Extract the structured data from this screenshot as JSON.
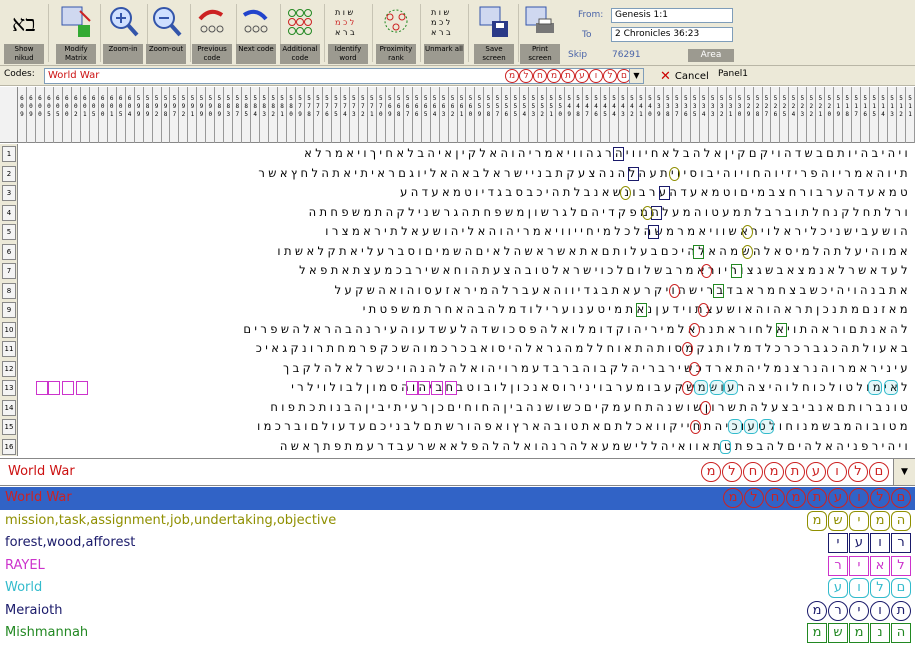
{
  "toolbar": {
    "buttons": [
      {
        "label": "Show nikud",
        "icon": "bet-alef-icon"
      },
      {
        "label": "Modify Matrix",
        "icon": "matrix-icon"
      },
      {
        "label": "Zoom-in",
        "icon": "zoom-in-icon"
      },
      {
        "label": "Zoom-out",
        "icon": "zoom-out-icon"
      },
      {
        "label": "Previous code",
        "icon": "previous-code-icon"
      },
      {
        "label": "Next code",
        "icon": "next-code-icon"
      },
      {
        "label": "Additional code",
        "icon": "additional-code-icon"
      },
      {
        "label": "Identify word",
        "icon": "identify-word-icon"
      },
      {
        "label": "Proximity rank",
        "icon": "proximity-rank-icon"
      },
      {
        "label": "Unmark all",
        "icon": "unmark-all-icon"
      },
      {
        "label": "Save screen",
        "icon": "save-screen-icon"
      },
      {
        "label": "Print screen",
        "icon": "print-screen-icon"
      }
    ]
  },
  "range": {
    "from_label": "From:",
    "from_value": "Genesis 1:1",
    "to_label": "To",
    "to_value": "2 Chronicles 36:23",
    "skip_label": "Skip",
    "skip_value": "76291",
    "area_label": "Area"
  },
  "codes": {
    "label": "Codes:",
    "value": "World War",
    "highlight": "מלחמתעולם",
    "cancel_label": "Cancel",
    "panel_label": "Panel1"
  },
  "column_numbers": [
    "6\n0\n9",
    "6\n0\n9",
    "6\n0\n0",
    "6\n0\n5",
    "6\n0\n5",
    "6\n0\n0",
    "6\n0\n2",
    "6\n0\n1",
    "6\n0\n5",
    "6\n0\n0",
    "6\n0\n1",
    "6\n0\n5",
    "6\n0\n4",
    "5\n9\n9",
    "5\n8\n9",
    "5\n9\n2",
    "5\n9\n8",
    "5\n9\n7",
    "5\n9\n2",
    "5\n9\n1",
    "5\n9\n9",
    "5\n9\n0",
    "5\n8\n9",
    "5\n8\n3",
    "5\n8\n7",
    "5\n8\n5",
    "5\n8\n4",
    "5\n8\n3",
    "5\n8\n2",
    "5\n8\n1",
    "5\n8\n0",
    "5\n7\n9",
    "5\n7\n8",
    "5\n7\n7",
    "5\n7\n6",
    "5\n7\n5",
    "5\n7\n4",
    "5\n7\n3",
    "5\n7\n2",
    "5\n7\n1",
    "5\n7\n0",
    "5\n6\n9",
    "5\n6\n8",
    "5\n6\n7",
    "5\n6\n6",
    "5\n6\n5",
    "5\n6\n4",
    "5\n6\n3",
    "5\n6\n2",
    "5\n6\n1",
    "5\n6\n0",
    "5\n5\n9",
    "5\n5\n8",
    "5\n5\n7",
    "5\n5\n6",
    "5\n5\n5",
    "5\n5\n4",
    "5\n5\n3",
    "5\n5\n2",
    "5\n5\n1",
    "5\n5\n0",
    "5\n4\n9",
    "5\n4\n8",
    "5\n4\n7",
    "5\n4\n6",
    "5\n4\n5",
    "5\n4\n4",
    "5\n4\n3",
    "5\n4\n2",
    "5\n4\n1",
    "5\n4\n0",
    "5\n3\n9",
    "5\n3\n8",
    "5\n3\n7",
    "5\n3\n6",
    "5\n3\n5",
    "5\n3\n4",
    "5\n3\n3",
    "5\n3\n2",
    "5\n3\n1",
    "5\n3\n0",
    "5\n2\n9",
    "5\n2\n8",
    "5\n2\n7",
    "5\n2\n6",
    "5\n2\n5",
    "5\n2\n4",
    "5\n2\n3",
    "5\n2\n2",
    "5\n2\n1",
    "5\n2\n0",
    "5\n1\n9",
    "5\n1\n8",
    "5\n1\n7",
    "5\n1\n6",
    "5\n1\n5",
    "5\n1\n4",
    "5\n1\n3",
    "5\n1\n2",
    "5\n1\n1"
  ],
  "matrix_rows": [
    {
      "num": "1",
      "text": "ויהיבהיותםבשדהויקםקיןאלהבלאחיוויהרגהוויאמריהוהאלקיןאיהבלאחיךויאמרלא"
    },
    {
      "num": "2",
      "text": "תיוהאמריוהפריזיוהחויוהיבוסיויתעהלהנהצעקתבניישראלבאהאליוגםראיתיאתהלחץאשר"
    },
    {
      "num": "3",
      "text": "טמאעדהערבורחצבמיםוטמאעדהערבונשאנבלתהיכבסבגדיוטמאעדהע"
    },
    {
      "num": "4",
      "text": "ורלתחלקנחלתוברבלתמעטוהמעלהמפקדיהםלגרשוןמשפחתהגרשנילקהתמשפחתה"
    },
    {
      "num": "5",
      "text": "הושעבישניכליראלויראשוויאמרמשהלכלמיחייוויאמריהוהאליהושעאלתיראמצרו"
    },
    {
      "num": "6",
      "text": "אמוהיעלתהלמיסאלהשמהאלהיכםבעלותםאתאשראשהלאיםהשמיםוסברעליאתקלאשתו"
    },
    {
      "num": "7",
      "text": "לעדאשרלאנמצאבשגצוריוראמרבשלוםלכוישראלטובהצעתהוחאשירבכמעצתאתפאל"
    },
    {
      "num": "8",
      "text": "אתבנהויהיכשבצחמראבדברישהויקרעאתבגדיווהאעברלהמיראזעסוהואהשקעל"
    },
    {
      "num": "9",
      "text": "מאזנםמתנכןתראהוהאושעצתוידעןנאתמיטענוערילודמלהבהאחרתמשפטתי"
    },
    {
      "num": "10",
      "text": "להאנתםוראהתויאלחוראתנראלמיריהוקדומלואלהפסכושדהלעשדעוהעירנהבהראלהשפרים"
    },
    {
      "num": "11",
      "text": "באעולתהכגברכרכלדמלותגקמסותהתאוחללמהגראלהיסואבכרכמוהשכקפרמחתרונקגאיכ"
    },
    {
      "num": "12",
      "text": "עיניראמרוהנרצנמליהתארדכשירבריהלקבוהברבדעמרויהואלהלהנהויכשרלאלהלקבך"
    },
    {
      "num": "13",
      "text": "לאימולטולכוחלוהיצהרעושמשקעבומערבוינירוסאנכוןלובוטבחביהוהסמוןלבולוילרי"
    },
    {
      "num": "14",
      "text": "טונברותםאנביבצעלהתשרוןשושנהתחעמקיםכשושנהביןהחוחיםכןרעיתיביןהבנותכתפוח"
    },
    {
      "num": "15",
      "text": "מטובוהמבשמנוחולטעוכיהתחייקוואכלתםאתטובהארץואפהורשתםלבניכםעדעולםוברכמו"
    },
    {
      "num": "16",
      "text": "ויהירפניהאלהיםלהבפתטתאוואיהללישמעאלהרנהואלהלהפלאאשרעבדרעמתפתךאשה"
    }
  ],
  "results": {
    "selected_term": "World War",
    "selected_glyphs": [
      "מ",
      "ל",
      "ח",
      "מ",
      "ת",
      "ע",
      "ו",
      "ל",
      "ם"
    ],
    "terms": [
      {
        "label": "World War",
        "color": "#cc2222",
        "glyph_shape": "circle",
        "glyphs": [
          "מ",
          "ל",
          "ח",
          "מ",
          "ת",
          "ע",
          "ו",
          "ל",
          "ם"
        ],
        "selected": true
      },
      {
        "label": "mission,task,assignment,job,undertaking,objective",
        "color": "#8f8f00",
        "glyph_shape": "hex",
        "glyphs": [
          "מ",
          "ש",
          "י",
          "מ",
          "ה"
        ],
        "selected": false
      },
      {
        "label": "forest,wood,afforest",
        "color": "#1a1a6a",
        "glyph_shape": "square",
        "glyphs": [
          "י",
          "ע",
          "ו",
          "ר"
        ],
        "selected": false
      },
      {
        "label": "RAYEL",
        "color": "#cc33cc",
        "glyph_shape": "square",
        "glyphs": [
          "ר",
          "י",
          "א",
          "ל"
        ],
        "selected": false
      },
      {
        "label": "World",
        "color": "#33bbcc",
        "glyph_shape": "hex",
        "glyphs": [
          "ע",
          "ו",
          "ל",
          "ם"
        ],
        "selected": false
      },
      {
        "label": "Meraioth",
        "color": "#1a1a6a",
        "glyph_shape": "circle",
        "glyphs": [
          "מ",
          "ר",
          "י",
          "ו",
          "ת"
        ],
        "selected": false
      },
      {
        "label": "Mishmannah",
        "color": "#228822",
        "glyph_shape": "square",
        "glyphs": [
          "מ",
          "ש",
          "מ",
          "נ",
          "ה"
        ],
        "selected": false
      }
    ]
  },
  "colors": {
    "selection_bg": "#3163c6",
    "accent_red": "#cc2222"
  }
}
